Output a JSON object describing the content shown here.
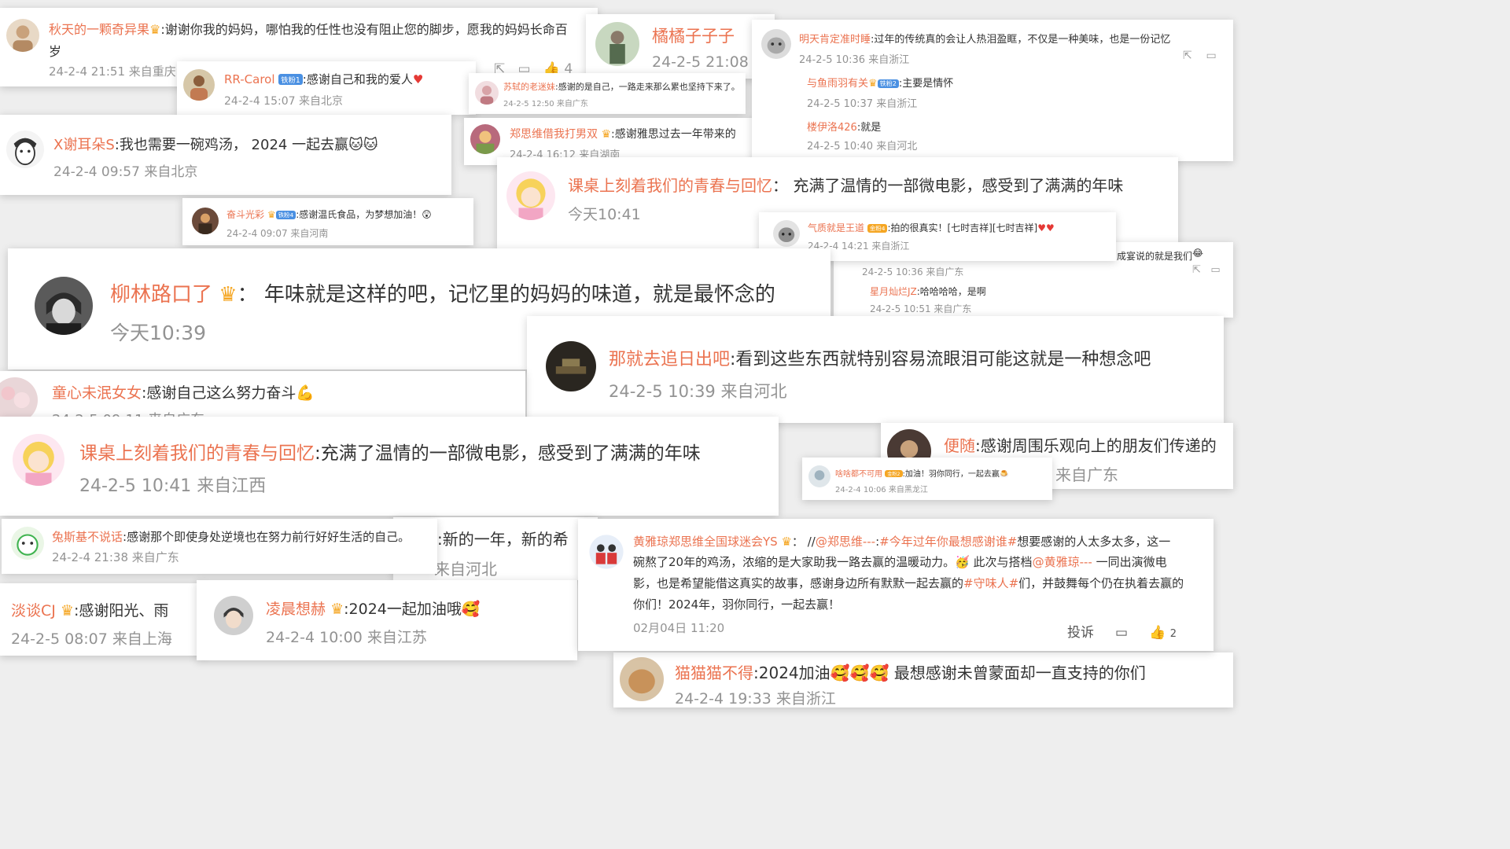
{
  "colors": {
    "name": "#eb7350",
    "text": "#333333",
    "meta": "#939393",
    "badge": "#4a90e2",
    "crown": "#f5a623"
  },
  "c1": {
    "name": "秋天的一颗奇异果",
    "text": ":谢谢你我的妈妈，哪怕我的任性也没有阻止您的脚步，愿我的妈妈长命百",
    "text2": "岁",
    "meta": "24-2-4 21:51 来自重庆"
  },
  "c2": {
    "name": "RR-Carol",
    "badge": "铁粉1",
    "text": ":感谢自己和我的爱人",
    "meta": "24-2-4 15:07 来自北京"
  },
  "c3": {
    "name": "橘橘子子子",
    "meta": "24-2-5 21:08",
    "likes": "4"
  },
  "c4": {
    "name": "苏轼的老迷妹",
    "text": ":感谢的是自己，一路走来那么累也坚持下来了。",
    "meta": "24-2-5 12:50 来自广东"
  },
  "c5": {
    "name": "明天肯定准时睡",
    "text": ":过年的传统真的会让人热泪盈眶，不仅是一种美味，也是一份记忆",
    "meta": "24-2-5 10:36 来自浙江",
    "r1": {
      "name": "与鱼雨羽有关",
      "badge": "铁粉2",
      "text": ":主要是情怀",
      "meta": "24-2-5 10:37 来自浙江"
    },
    "r2": {
      "name": "楼伊洛426",
      "text": ":就是",
      "meta": "24-2-5 10:40 来自河北"
    }
  },
  "c6": {
    "name": "X谢耳朵S",
    "text": ":我也需要一碗鸡汤， 2024 一起去赢",
    "meta": "24-2-4 09:57 来自北京"
  },
  "c7": {
    "name": "郑思维借我打男双",
    "text": ":感谢雅思过去一年带来的",
    "meta": "24-2-4 16:12 来自湖南"
  },
  "c8": {
    "name": "课桌上刻着我们的青春与回忆",
    "text": "： 充满了温情的一部微电影，感受到了满满的年味",
    "meta": "今天10:41"
  },
  "c9": {
    "name": "奋斗光彩",
    "badge": "铁粉4",
    "text": ":感谢温氏食品，为梦想加油！",
    "meta": "24-2-4 09:07 来自河南"
  },
  "c10": {
    "name": "气质就是王道",
    "badge": "金粉4",
    "text": ":拍的很真实！[七时吉祥][七时吉祥]",
    "meta": "24-2-4 14:21 来自浙江"
  },
  "c11": {
    "text": "成宴说的就是我们",
    "meta": "24-2-5 10:36 来自广东",
    "r1": {
      "name": "星月灿烂JZ",
      "text": ":哈哈哈哈，是啊",
      "meta": "24-2-5 10:51 来自广东"
    }
  },
  "c12": {
    "name": "柳林路口了",
    "text": "： 年味就是这样的吧，记忆里的妈妈的味道，就是最怀念的",
    "meta": "今天10:39"
  },
  "c13": {
    "name": "那就去追日出吧",
    "text": ":看到这些东西就特别容易流眼泪可能这就是一种想念吧",
    "meta": "24-2-5 10:39 来自河北"
  },
  "c14": {
    "name": "童心未泯女女",
    "text": ":感谢自己这么努力奋斗",
    "meta": "24-2-5 09:11 来自广东"
  },
  "c15": {
    "name": "课桌上刻着我们的青春与回忆",
    "text": ":充满了温情的一部微电影，感受到了满满的年味",
    "meta": "24-2-5 10:41 来自江西"
  },
  "c16": {
    "name": "便随",
    "text": ":感谢周围乐观向上的朋友们传递的",
    "meta": "来自广东"
  },
  "c17": {
    "name": "啥啥都不可用",
    "badge": "金粉2",
    "text": ":加油！羽你同行，一起去赢",
    "meta": "24-2-4 10:06 来自黑龙江"
  },
  "c18": {
    "name": "兔斯基不说话",
    "text": ":感谢那个即使身处逆境也在努力前行好好生活的自己。",
    "meta": "24-2-4 21:38 来自广东"
  },
  "c19": {
    "text": ":新的一年，新的希",
    "meta": "来自河北"
  },
  "c20": {
    "name": "黄雅琼郑思维全国球迷会YS",
    "text_a": "： //",
    "link1": "@郑思维---",
    "text_b": ":",
    "link2": "#今年过年你最想感谢谁#",
    "text_c": "想要感谢的人太多太多，这一",
    "line2": "碗熬了20年的鸡汤，浓缩的是大家助我一路去赢的温暖动力。",
    "line2b": " 此次与搭档",
    "link3": "@黄雅琼---",
    "line2c": " 一同出演微电",
    "line3a": "影，也是希望能借这真实的故事，感谢身边所有默默一起去赢的",
    "link4": "#守味人#",
    "line3b": "们，并鼓舞每个仍在执着去赢的",
    "line4": "你们！2024年，羽你同行，一起去赢！",
    "meta": "02月04日 11:20",
    "report": "投诉",
    "likes": "2"
  },
  "c21": {
    "name": "淡谈CJ",
    "text": ":感谢阳光、雨",
    "meta": "24-2-5 08:07 来自上海"
  },
  "c22": {
    "name": "凌晨想赫",
    "text": ":2024一起加油哦",
    "meta": "24-2-4 10:00 来自江苏"
  },
  "c23": {
    "name": "猫猫猫不得",
    "text": ":2024加油",
    "text2": " 最想感谢未曾蒙面却一直支持的你们",
    "meta": "24-2-4 19:33 来自浙江"
  },
  "icons": {
    "share": "share-icon",
    "comment": "comment-icon",
    "like": "like-icon",
    "crown": "crown-icon"
  }
}
